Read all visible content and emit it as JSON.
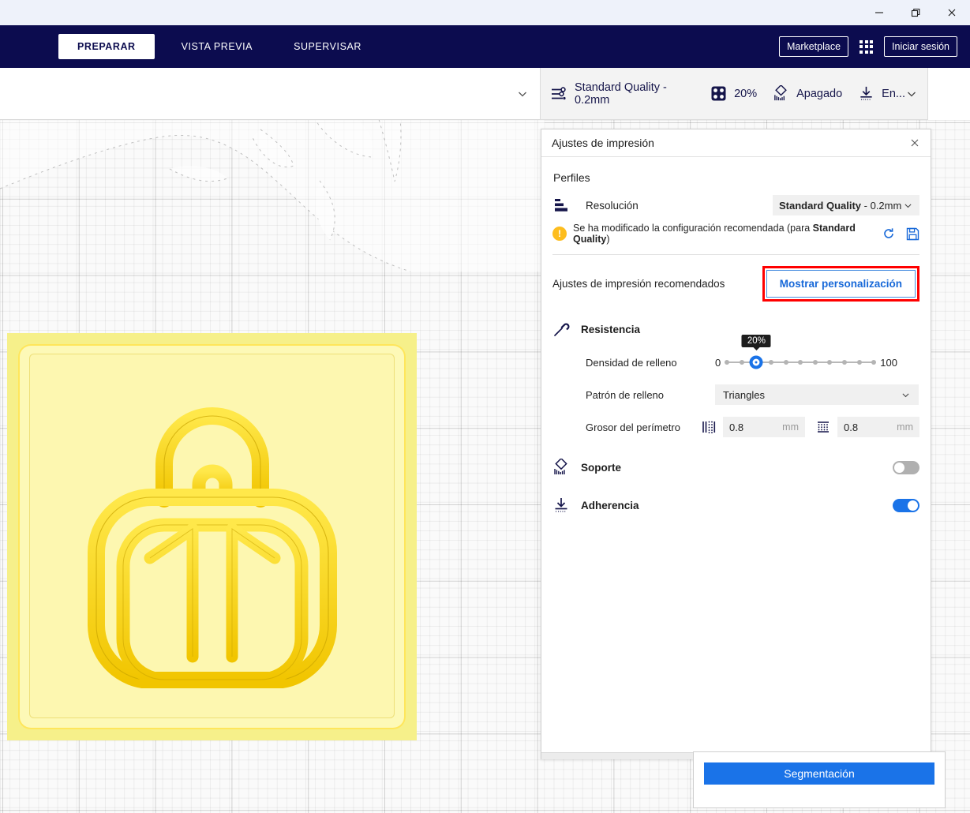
{
  "window": {
    "controls": [
      {
        "name": "minimize-button",
        "glyph": "minimize"
      },
      {
        "name": "restore-button",
        "glyph": "restore"
      },
      {
        "name": "close-button",
        "glyph": "close"
      }
    ]
  },
  "nav": {
    "stages": [
      {
        "label": "PREPARAR",
        "active": true
      },
      {
        "label": "VISTA PREVIA",
        "active": false
      },
      {
        "label": "SUPERVISAR",
        "active": false
      }
    ],
    "marketplace_label": "Marketplace",
    "signin_label": "Iniciar sesión",
    "apps_icon": "apps-grid-icon",
    "brand_color": "#0c0c4f"
  },
  "config_bar": {
    "profile_icon": "print-settings-sliders-icon",
    "profile_text": "Standard Quality - 0.2mm",
    "infill_icon": "infill-icon",
    "infill_text": "20%",
    "support_icon": "support-icon",
    "support_text": "Apagado",
    "adhesion_icon": "adhesion-icon",
    "adhesion_text": "En...",
    "caret_icon": "chevron-down-icon"
  },
  "panel": {
    "title": "Ajustes de impresión",
    "close_icon": "close-icon",
    "profiles_label": "Perfiles",
    "resolution": {
      "icon": "resolution-layers-icon",
      "label": "Resolución",
      "value_bold": "Standard Quality",
      "value_rest": " - 0.2mm",
      "caret_icon": "chevron-down-icon"
    },
    "warning": {
      "badge": "!",
      "text_before": "Se ha modificado la configuración recomendada (para ",
      "text_bold": "Standard Quality",
      "text_after": ")",
      "revert_icon": "revert-circular-arrow-icon",
      "save_icon": "save-floppy-icon",
      "accent": "#1768d8"
    },
    "recommended_label": "Ajustes de impresión recomendados",
    "custom_button_label": "Mostrar personalización",
    "highlight_color": "#ff0000",
    "strength": {
      "icon": "strength-hammer-icon",
      "title": "Resistencia",
      "infill": {
        "label": "Densidad de relleno",
        "min": "0",
        "max": "100",
        "value": 20,
        "bubble": "20%",
        "ticks": [
          0,
          10,
          20,
          30,
          40,
          50,
          60,
          70,
          80,
          90,
          100
        ]
      },
      "pattern": {
        "label": "Patrón de relleno",
        "value": "Triangles",
        "caret_icon": "chevron-down-icon"
      },
      "perimeter": {
        "label": "Grosor del perímetro",
        "wall_icon": "wall-thickness-icon",
        "wall_value": "0.8",
        "wall_unit": "mm",
        "top_icon": "top-bottom-thickness-icon",
        "top_value": "0.8",
        "top_unit": "mm"
      }
    },
    "support": {
      "icon": "support-icon",
      "label": "Soporte",
      "enabled": false
    },
    "adhesion": {
      "icon": "adhesion-icon",
      "label": "Adherencia",
      "enabled": true
    }
  },
  "action": {
    "slice_label": "Segmentación",
    "accent": "#1a73e8"
  },
  "model": {
    "name": "backpack-keychain-model",
    "color": "#f6f08a"
  }
}
